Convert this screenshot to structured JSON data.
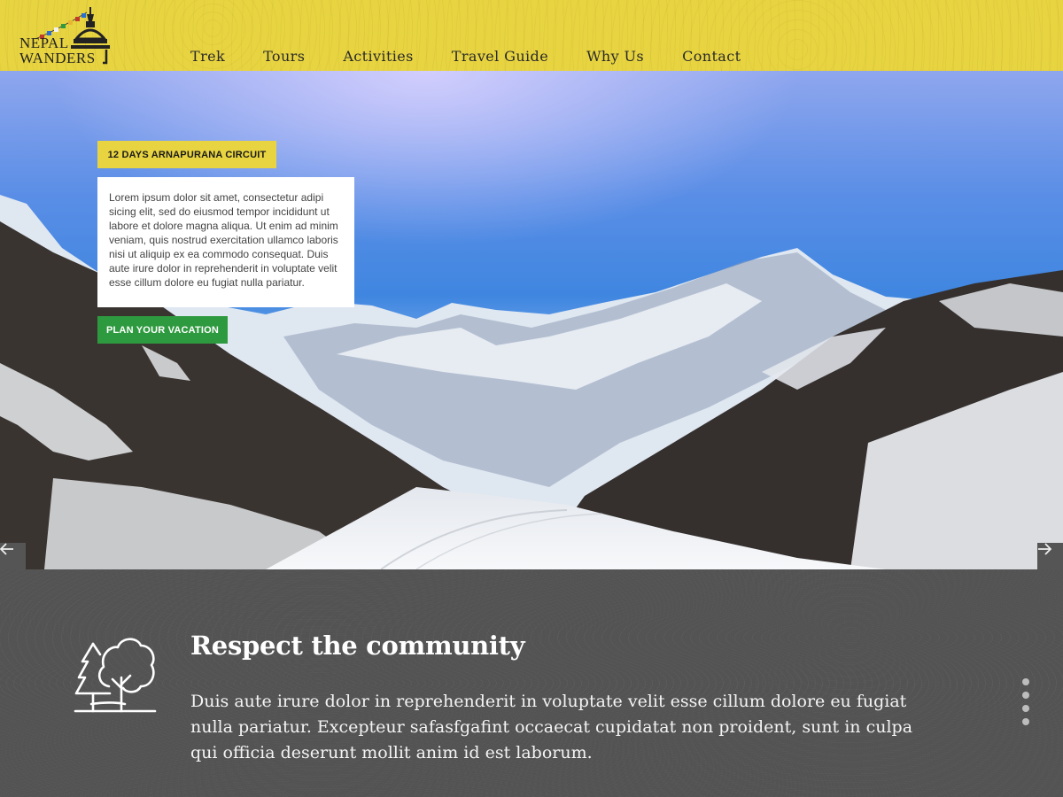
{
  "brand": {
    "line1": "Nepal",
    "line2": "Wanders"
  },
  "nav": {
    "items": [
      {
        "label": "Trek"
      },
      {
        "label": "Tours"
      },
      {
        "label": "Activities"
      },
      {
        "label": "Travel Guide"
      },
      {
        "label": "Why Us"
      },
      {
        "label": "Contact"
      }
    ]
  },
  "hero": {
    "tag": "12 DAYS ARNAPURANA CIRCUIT",
    "description": "Lorem ipsum dolor sit amet, consectetur adipi sicing elit, sed do eiusmod tempor incididunt ut labore et dolore magna aliqua. Ut enim ad minim veniam, quis nostrud exercitation ullamco laboris nisi ut aliquip ex ea commodo consequat. Duis aute irure dolor in reprehenderit in voluptate velit esse cillum dolore eu fugiat nulla pariatur.",
    "cta_label": "PLAN YOUR VACATION"
  },
  "feature": {
    "title": "Respect the community",
    "body": "Duis aute irure dolor in reprehenderit in voluptate velit esse cillum dolore eu fugiat nulla pariatur. Excepteur safasfgafint occaecat cupidatat non proident, sunt in culpa qui officia deserunt mollit anim id est laborum."
  },
  "colors": {
    "header_bg": "#e8d440",
    "cta_green": "#2e9a3f",
    "section_bg": "#535353"
  },
  "icons": [
    "stupa-logo-icon",
    "arrow-left-icon",
    "arrow-right-icon",
    "trees-icon"
  ]
}
